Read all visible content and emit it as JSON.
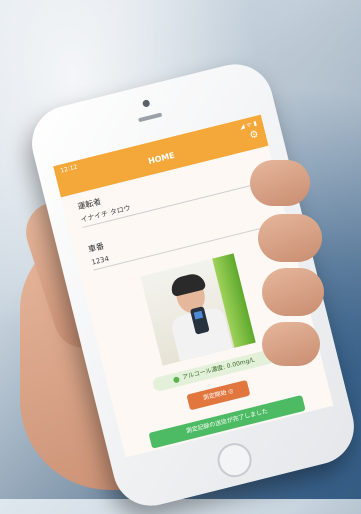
{
  "status": {
    "time": "12:12",
    "icons": "◢ ᯤ ▮"
  },
  "header": {
    "title": "HOME",
    "settings_icon": "gear-icon"
  },
  "form": {
    "driver_label": "運転者",
    "driver_value": "イナイチ タロウ",
    "vehicle_label": "車番",
    "vehicle_value": "1234"
  },
  "result": {
    "alcohol_text": "アルコール濃度: 0.00mg/L"
  },
  "buttons": {
    "measure_label": "測定開始",
    "complete_label": "測定記録の送信が完了しました"
  },
  "colors": {
    "header": "#f4a83a",
    "measure": "#e2763f",
    "complete": "#4dbb63"
  }
}
